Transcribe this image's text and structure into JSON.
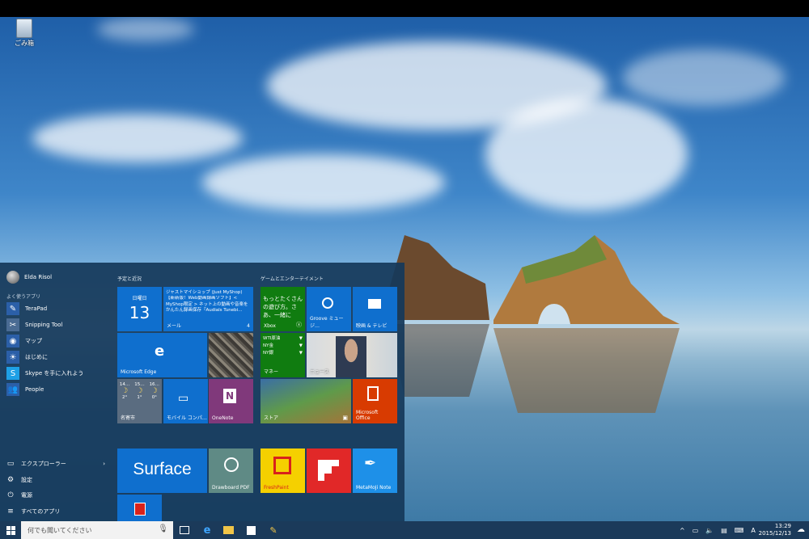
{
  "desktop": {
    "recycle_bin_label": "ごみ箱"
  },
  "start": {
    "user_name": "Elda Risol",
    "most_used_label": "よく使うアプリ",
    "apps": [
      {
        "label": "TeraPad",
        "color": "#2b5fa8",
        "icon": "terapad-icon"
      },
      {
        "label": "Snipping Tool",
        "color": "#4a6b93",
        "icon": "scissors-icon"
      },
      {
        "label": "マップ",
        "color": "#2b5fa8",
        "icon": "map-pin-icon"
      },
      {
        "label": "はじめに",
        "color": "#2b5fa8",
        "icon": "lightbulb-icon"
      },
      {
        "label": "Skype を手に入れよう",
        "color": "#1ea0e6",
        "icon": "skype-icon"
      },
      {
        "label": "People",
        "color": "#2b5fa8",
        "icon": "people-icon"
      }
    ],
    "bottom": {
      "explorer": "エクスプローラー",
      "settings": "設定",
      "power": "電源",
      "all_apps": "すべてのアプリ"
    },
    "groups": {
      "left": "予定と近況",
      "right": "ゲームとエンターテイメント"
    },
    "tiles": {
      "calendar_day": "日曜日",
      "calendar_date": "13",
      "mail_sender": "ジャストマイショップ (Just MyShop)",
      "mail_body": "【新新版！Web動画録画ソフト】< MyShop限定 > ネット上の動画や音楽をかんたん録画保存『Audials Tunebi…",
      "mail_label": "メール",
      "mail_count": "4",
      "edge_label": "Microsoft Edge",
      "weather_days": [
        "14…",
        "15…",
        "16…"
      ],
      "weather_temps": [
        "2°",
        "1°",
        "0°"
      ],
      "weather_label": "名寄市",
      "mobile_label": "モバイル コンパ…",
      "onenote_label": "OneNote",
      "xbox_text": "もっとたくさんの遊び方。さあ、一緒に",
      "xbox_label": "Xbox",
      "groove_label": "Groove ミュージ…",
      "movies_label": "映画 & テレビ",
      "money_rows": [
        {
          "name": "WTI原油",
          "dir": "▼"
        },
        {
          "name": "NY金",
          "dir": "▼"
        },
        {
          "name": "NY銀",
          "dir": "▼"
        }
      ],
      "money_label": "マネー",
      "news_label": "ニュース",
      "store_label": "ストア",
      "office_label": "Microsoft Office",
      "surface_text": "Surface",
      "drawboard_label": "Drawboard PDF",
      "freshpaint_label": "FreshPaint",
      "metamoji_label": "MetaMoJi Note"
    }
  },
  "taskbar": {
    "search_placeholder": "何でも聞いてください",
    "time": "13:29",
    "date": "2015/12/13",
    "ime": "A"
  },
  "colors": {
    "tile_blue": "#0f6fce",
    "xbox_green": "#107c10",
    "office_orange": "#d83b01",
    "onenote_purple": "#80397b"
  }
}
